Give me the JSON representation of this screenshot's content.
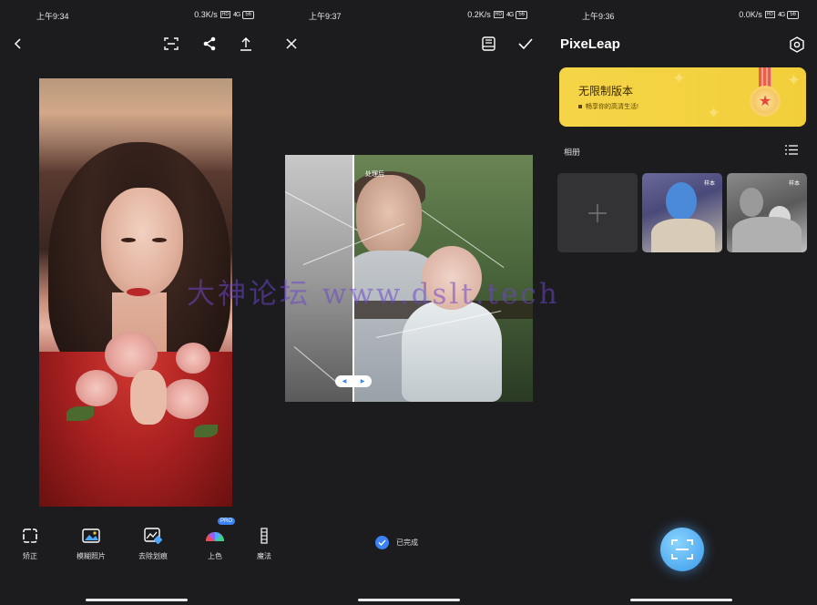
{
  "panels": [
    {
      "status": {
        "time": "上午9:34",
        "speed": "0.3K/s",
        "hd": "HD",
        "network": "4G",
        "battery": "56"
      },
      "toolbar": {
        "back": "back-icon",
        "scan": "scan-icon",
        "share": "share-icon",
        "export": "export-icon"
      },
      "tools": [
        {
          "label": "矫正",
          "icon": "crop-icon"
        },
        {
          "label": "模糊照片",
          "icon": "photo-icon"
        },
        {
          "label": "去除划痕",
          "icon": "scratch-remove-icon"
        },
        {
          "label": "上色",
          "icon": "colorize-icon",
          "badge": "PRO"
        },
        {
          "label": "魔法",
          "icon": "magic-icon"
        }
      ]
    },
    {
      "status": {
        "time": "上午9:37",
        "speed": "0.2K/s",
        "hd": "HD",
        "network": "4G",
        "battery": "56"
      },
      "toolbar": {
        "close": "close-icon",
        "compare": "book-icon",
        "confirm": "check-icon"
      },
      "compare": {
        "after_label": "处理后",
        "handle_left": "◀",
        "handle_right": "▶"
      },
      "done_label": "已完成"
    },
    {
      "status": {
        "time": "上午9:36",
        "speed": "0.0K/s",
        "hd": "HD",
        "network": "4G",
        "battery": "56"
      },
      "brand": "PixeLeap",
      "banner": {
        "title": "无限制版本",
        "subtitle": "畅享你的高清生活!"
      },
      "album": {
        "label": "相册",
        "sample_tag": "样本"
      },
      "settings": "settings-icon"
    }
  ],
  "watermark": "大神论坛 www.dslt.tech",
  "colors": {
    "accent": "#3b82f6",
    "background": "#1c1c1e",
    "banner": "#f5d547"
  }
}
